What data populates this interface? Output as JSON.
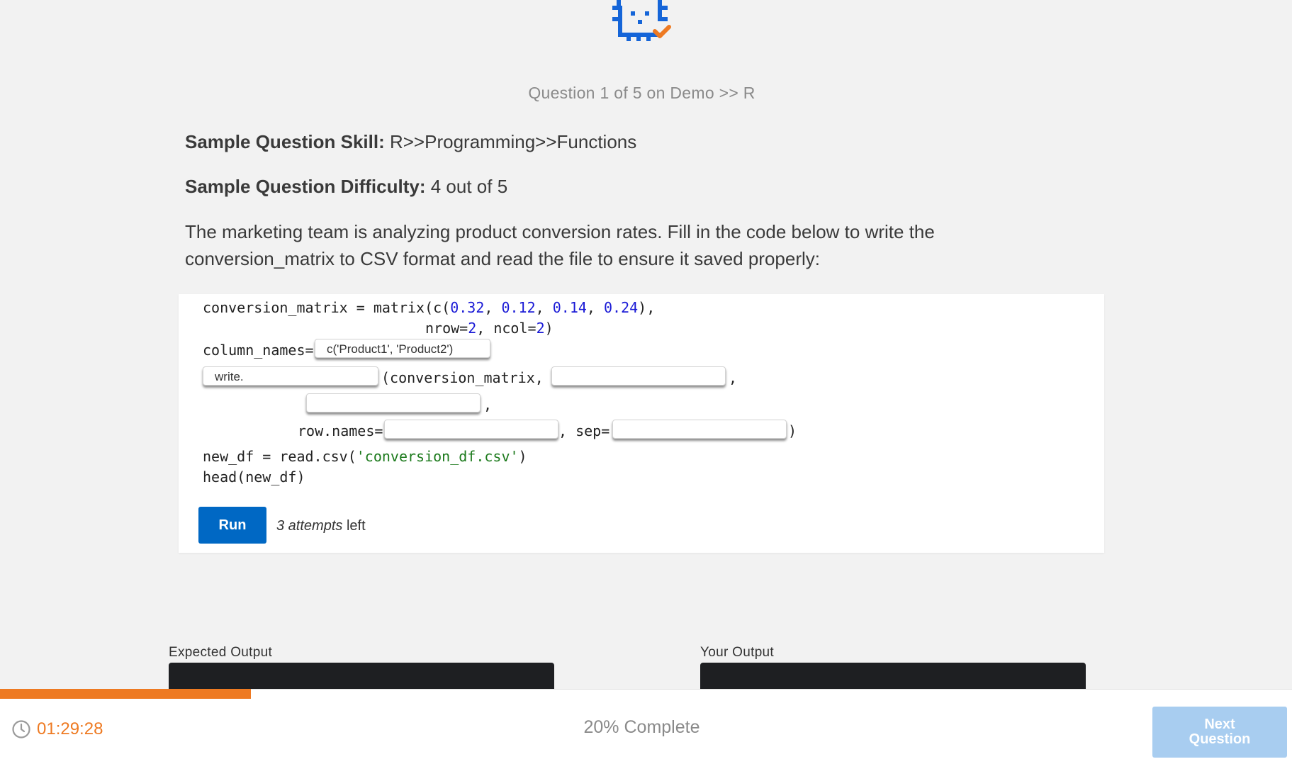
{
  "header": {
    "question_label": "Question 1 of 5 on Demo >> R"
  },
  "question": {
    "skill_label": "Sample Question Skill:",
    "skill_value": "R>>Programming>>Functions",
    "difficulty_label": "Sample Question Difficulty:",
    "difficulty_value": "4 out of 5",
    "text": "The marketing team is analyzing product conversion rates. Fill in the code below to write the conversion_matrix to CSV format and read the file to ensure it saved properly:"
  },
  "code": {
    "line1_a": "conversion_matrix = matrix(c(",
    "line1_n1": "0.32",
    "line1_s1": ", ",
    "line1_n2": "0.12",
    "line1_s2": ", ",
    "line1_n3": "0.14",
    "line1_s3": ", ",
    "line1_n4": "0.24",
    "line1_end": "),",
    "line2_a": "nrow=",
    "line2_n1": "2",
    "line2_b": ", ncol=",
    "line2_n2": "2",
    "line2_end": ")",
    "line3_label": "column_names=",
    "line4_mid": "(conversion_matrix,",
    "comma": ",",
    "line6_label": "row.names=",
    "line6_sep": ", sep=",
    "line6_end": ")",
    "line7_a": "new_df = read.csv(",
    "line7_str": "'conversion_df.csv'",
    "line7_end": ")",
    "line8": "head(new_df)"
  },
  "blanks": {
    "column_names_value": "c('Product1', 'Product2')",
    "write_func_value": "write.",
    "arg2_value": "",
    "arg3_value": "",
    "row_names_value": "",
    "sep_value": ""
  },
  "run": {
    "button_label": "Run",
    "attempts_count": "3 attempts",
    "attempts_suffix": " left"
  },
  "outputs": {
    "expected_label": "Expected Output",
    "yours_label": "Your Output"
  },
  "footer": {
    "timer": "01:29:28",
    "progress_label": "20% Complete",
    "progress_fraction": 0.2,
    "next_label_line1": "Next",
    "next_label_line2": "Question"
  },
  "colors": {
    "accent_orange": "#ee7a22",
    "primary_blue": "#0068c4",
    "next_disabled": "#a8cdf0",
    "logo_blue": "#1565d8"
  },
  "icons": {
    "logo": "chip-check-logo",
    "timer": "clock-icon"
  }
}
